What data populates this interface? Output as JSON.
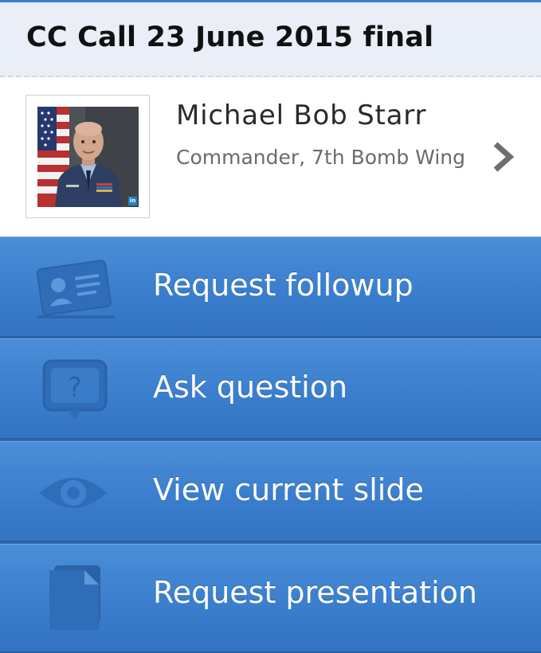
{
  "header": {
    "title": "CC Call 23 June 2015 final"
  },
  "profile": {
    "name": "Michael Bob Starr",
    "role": "Commander, 7th Bomb Wing",
    "badge": "in",
    "photo_icon": "person-photo"
  },
  "actions": [
    {
      "label": "Request followup",
      "icon": "contact-card-icon"
    },
    {
      "label": "Ask question",
      "icon": "question-bubble-icon"
    },
    {
      "label": "View current slide",
      "icon": "eye-icon"
    },
    {
      "label": "Request presentation",
      "icon": "document-icon"
    }
  ],
  "colors": {
    "header_bg": "#e9eef7",
    "accent": "#3b7fd0",
    "action_bg": "#3a7ecd",
    "icon_fill": "#2f6db8"
  }
}
